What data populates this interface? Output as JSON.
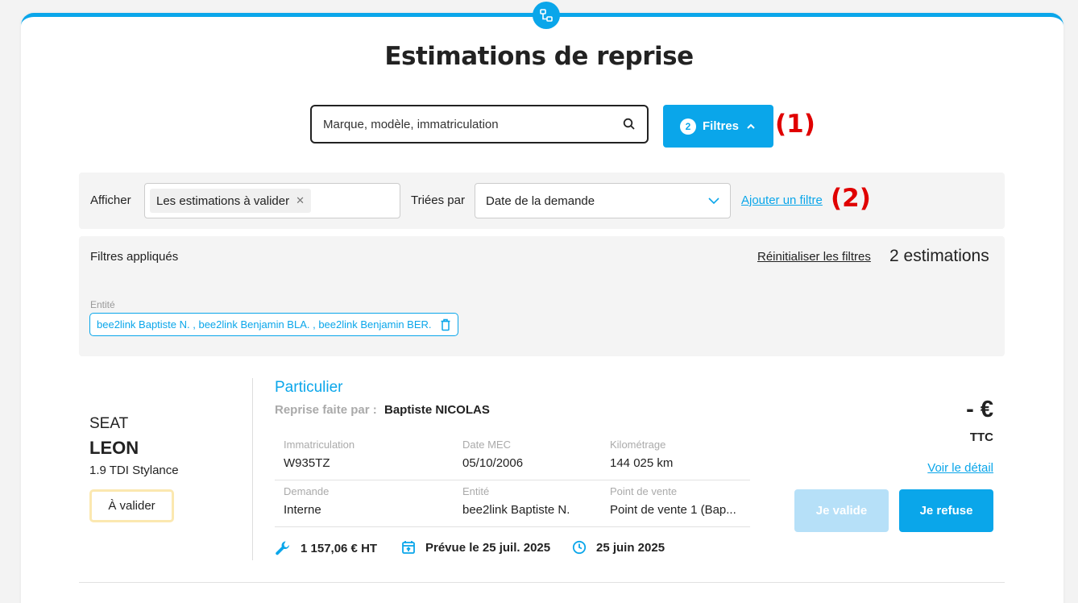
{
  "page": {
    "title": "Estimations de reprise"
  },
  "search": {
    "placeholder": "Marque, modèle, immatriculation"
  },
  "filters_button": {
    "count": "2",
    "label": "Filtres"
  },
  "annotations": [
    "(1)",
    "(2)"
  ],
  "filter_bar": {
    "show_label": "Afficher",
    "show_chip": "Les estimations à valider",
    "sort_label": "Triées par",
    "sort_value": "Date de la demande",
    "add_filter": "Ajouter un filtre"
  },
  "applied": {
    "title": "Filtres appliqués",
    "reset": "Réinitialiser les filtres",
    "count": "2 estimations",
    "entity_label": "Entité",
    "entity_value": "bee2link Baptiste N. , bee2link Benjamin BLA. , bee2link Benjamin BER."
  },
  "estimate": {
    "brand": "SEAT",
    "model": "LEON",
    "version": "1.9 TDI Stylance",
    "status": "À valider",
    "owner_type": "Particulier",
    "taken_by_label": "Reprise faite par :",
    "taken_by": "Baptiste NICOLAS",
    "fields": {
      "plate_label": "Immatriculation",
      "plate": "W935TZ",
      "mec_label": "Date MEC",
      "mec": "05/10/2006",
      "km_label": "Kilométrage",
      "km": "144 025 km",
      "request_label": "Demande",
      "request": "Interne",
      "entity_label": "Entité",
      "entity": "bee2link Baptiste N.",
      "pos_label": "Point de vente",
      "pos": "Point de vente 1 (Bap..."
    },
    "repair_cost": "1 157,06 € HT",
    "planned": "Prévue le 25 juil. 2025",
    "created": "25 juin 2025",
    "price": "- €",
    "price_suffix": "TTC",
    "detail_link": "Voir le détail",
    "validate_label": "Je valide",
    "refuse_label": "Je refuse"
  },
  "colors": {
    "accent": "#0aa6ea",
    "status_border": "#fbe8b0",
    "annotation": "#e00000"
  }
}
